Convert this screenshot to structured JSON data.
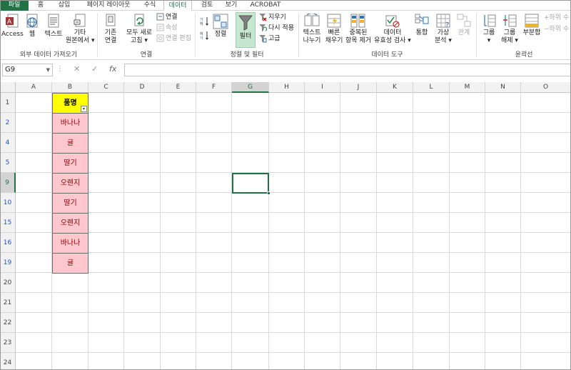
{
  "tabs": [
    "파일",
    "홈",
    "삽입",
    "페이지 레이아웃",
    "수식",
    "데이터",
    "검토",
    "보기",
    "ACROBAT"
  ],
  "active_tab": "데이터",
  "ribbon": {
    "ext": {
      "access": "Access",
      "web": "웹",
      "text": "텍스트",
      "other1": "기타",
      "other2": "원본에서 ▾",
      "label": "외부 데이터 가져오기"
    },
    "existing": {
      "l1": "기존",
      "l2": "연결"
    },
    "refresh": {
      "l1": "모두 새로",
      "l2": "고침 ▾"
    },
    "conn": {
      "connections": "연결",
      "properties": "속성",
      "edit_links": "연결 편집",
      "label": "연결"
    },
    "sort": {
      "sort_btn": "정렬",
      "filter_btn": "필터",
      "clear": "지우기",
      "reapply": "다시 적용",
      "advanced": "고급",
      "label": "정렬 및 필터"
    },
    "tools": {
      "t2c_1": "텍스트",
      "t2c_2": "나누기",
      "flash_1": "빠른",
      "flash_2": "채우기",
      "dup_1": "중복된",
      "dup_2": "항목 제거",
      "val_1": "데이터",
      "val_2": "유효성 검사 ▾",
      "consolidate": "통합",
      "whatif_1": "가상",
      "whatif_2": "분석 ▾",
      "relations": "관계",
      "label": "데이터 도구"
    },
    "outline": {
      "group_1": "그룹",
      "group_2": "▾",
      "ungroup_1": "그룹",
      "ungroup_2": "해제 ▾",
      "subtotal": "부분합",
      "show_detail": "하위 수",
      "hide_detail": "하위 수",
      "label": "윤곽선"
    }
  },
  "formula_bar": {
    "name_box": "G9",
    "cancel": "✕",
    "enter": "✓",
    "fx": "fx",
    "formula": ""
  },
  "columns": [
    "A",
    "B",
    "C",
    "D",
    "E",
    "F",
    "G",
    "H",
    "I",
    "J",
    "K",
    "L",
    "M",
    "N",
    "O"
  ],
  "selected_column": "G",
  "rows": [
    {
      "num": "1",
      "filtered": false
    },
    {
      "num": "2",
      "filtered": true
    },
    {
      "num": "4",
      "filtered": true
    },
    {
      "num": "5",
      "filtered": true
    },
    {
      "num": "9",
      "filtered": true
    },
    {
      "num": "10",
      "filtered": true
    },
    {
      "num": "15",
      "filtered": true
    },
    {
      "num": "16",
      "filtered": true
    },
    {
      "num": "19",
      "filtered": true
    },
    {
      "num": "20",
      "filtered": false
    },
    {
      "num": "21",
      "filtered": false
    },
    {
      "num": "22",
      "filtered": false
    },
    {
      "num": "23",
      "filtered": false
    },
    {
      "num": "24",
      "filtered": false
    }
  ],
  "selected_row": "9",
  "table": {
    "header": "품명",
    "filter_icon": "filter-active-icon",
    "values": [
      "바나나",
      "귤",
      "딸기",
      "오렌지",
      "딸기",
      "오렌지",
      "바나나",
      "귤"
    ]
  },
  "colors": {
    "accent": "#217346",
    "header_fill": "#ffff00",
    "highlight_fill": "#ffc7ce",
    "highlight_text": "#9c0006",
    "filtered_row_num": "#1f4fd8"
  }
}
